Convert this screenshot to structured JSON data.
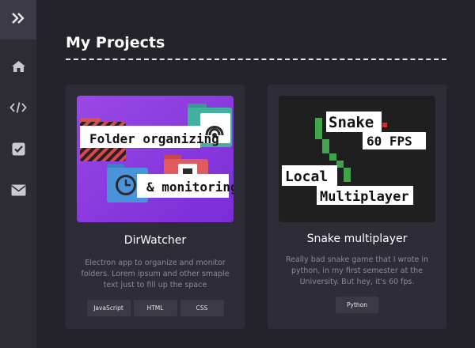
{
  "page": {
    "title": "My Projects"
  },
  "sidebar": {
    "toggle_icon": "double-chevron-right-icon",
    "items": [
      {
        "id": "home",
        "icon": "home-icon"
      },
      {
        "id": "code",
        "icon": "code-icon"
      },
      {
        "id": "tasks",
        "icon": "checkbox-icon"
      },
      {
        "id": "contact",
        "icon": "envelope-icon"
      }
    ]
  },
  "projects": [
    {
      "title": "DirWatcher",
      "description": "Electron app to organize and monitor folders. Lorem ipsum and other smaple text just to fill up the space",
      "thumbnail": {
        "line1": "Folder organizing",
        "line2": "& monitoring"
      },
      "tags": [
        "JavaScript",
        "HTML",
        "CSS"
      ]
    },
    {
      "title": "Snake multiplayer",
      "description": "Really bad snake game that I wrote in python, in my first semester at the University. But hey, it's 60 fps.",
      "thumbnail": {
        "line1": "Snake",
        "line2": "60 FPS",
        "line3": "Local",
        "line4": "Multiplayer"
      },
      "tags": [
        "Python"
      ]
    }
  ],
  "colors": {
    "background": "#24232b",
    "sidebar": "#2d2c35",
    "card": "#2e2d37",
    "tag": "#3a3944",
    "accent_purple": "#8a3ae0",
    "snake_green": "#3fa44a",
    "snake_food": "#e02a2a"
  }
}
